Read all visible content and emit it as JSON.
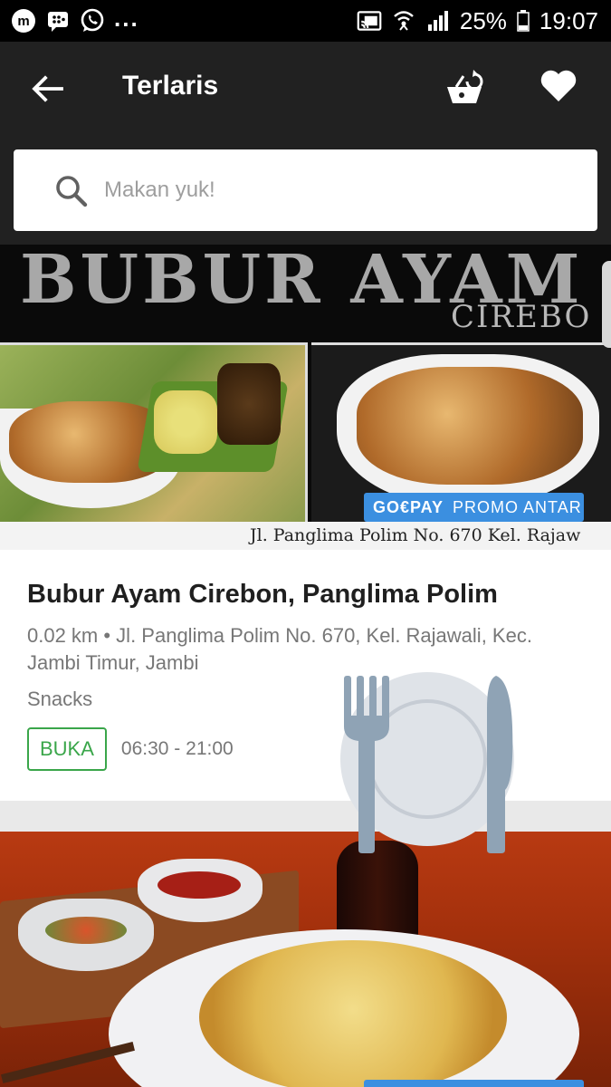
{
  "status_bar": {
    "icons_left": [
      "m-app-icon",
      "bbm-icon",
      "whatsapp-icon"
    ],
    "more_indicator": "...",
    "icons_right": [
      "cast-icon",
      "wifi-icon",
      "signal-icon",
      "battery-icon"
    ],
    "battery_percent": "25%",
    "time": "19:07"
  },
  "app_bar": {
    "title": "Terlaris",
    "back_icon": "arrow-left-icon",
    "basket_icon": "basket-icon",
    "favorite_icon": "heart-icon",
    "background": "#212121"
  },
  "search": {
    "placeholder": "Makan yuk!",
    "icon": "search-icon"
  },
  "restaurants": [
    {
      "banner": {
        "headline": "BUBUR AYAM",
        "subline": "CIREBO",
        "address_strip": "Jl. Panglima Polim No. 670 Kel. Rajaw"
      },
      "badge": {
        "brand": "GO€PAY",
        "label": "PROMO ANTAR",
        "color": "#3b8fe0"
      },
      "name": "Bubur Ayam Cirebon, Panglima Polim",
      "address": "0.02 km • Jl. Panglima Polim No. 670, Kel. Rajawali, Kec. Jambi Timur, Jambi",
      "category": "Snacks",
      "status": "BUKA",
      "status_color": "#3aa64a",
      "hours": "06:30 - 21:00"
    },
    {
      "banner_description_icon": "noodle-plate-photo"
    }
  ],
  "overlay_icon": "fork-knife-plate-icon"
}
